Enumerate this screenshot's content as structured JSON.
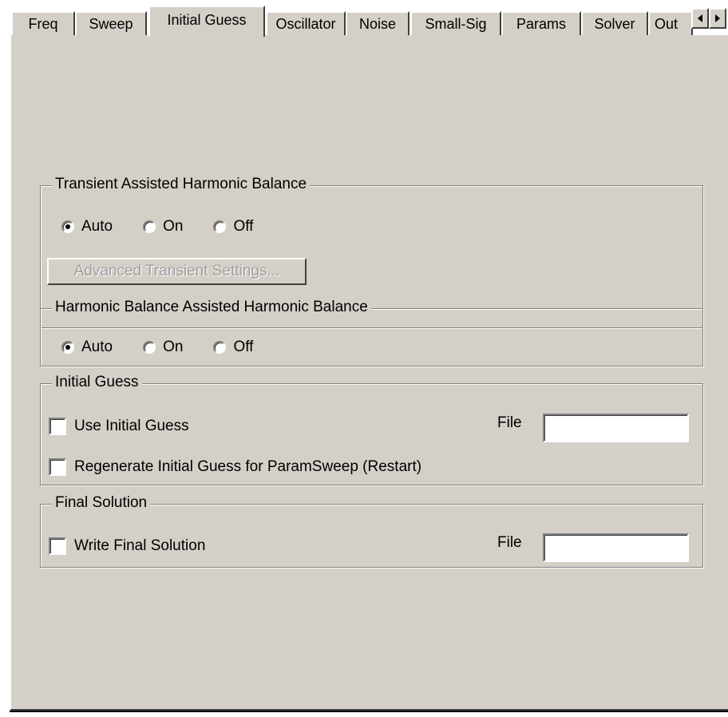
{
  "tabs": [
    {
      "label": "Freq"
    },
    {
      "label": "Sweep"
    },
    {
      "label": "Initial Guess",
      "active": true
    },
    {
      "label": "Oscillator"
    },
    {
      "label": "Noise"
    },
    {
      "label": "Small-Sig"
    },
    {
      "label": "Params"
    },
    {
      "label": "Solver"
    },
    {
      "label": "Out"
    }
  ],
  "tab_scroll": {
    "left_icon": "arrow-left-icon",
    "right_icon": "arrow-right-icon"
  },
  "transient_group": {
    "title": "Transient Assisted Harmonic Balance",
    "options": [
      "Auto",
      "On",
      "Off"
    ],
    "selected": "Auto",
    "advanced_button": "Advanced Transient Settings..."
  },
  "hb_group": {
    "title": "Harmonic Balance Assisted Harmonic Balance",
    "options": [
      "Auto",
      "On",
      "Off"
    ],
    "selected": "Auto"
  },
  "initial_guess_group": {
    "title": "Initial Guess",
    "use_label": "Use Initial Guess",
    "use_checked": false,
    "regen_label": "Regenerate Initial Guess for ParamSweep (Restart)",
    "regen_checked": false,
    "file_label": "File",
    "file_value": ""
  },
  "final_solution_group": {
    "title": "Final Solution",
    "write_label": "Write Final Solution",
    "write_checked": false,
    "file_label": "File",
    "file_value": ""
  },
  "colors": {
    "face": "#d4d0c8",
    "disabled_text": "#a0a0a0"
  }
}
